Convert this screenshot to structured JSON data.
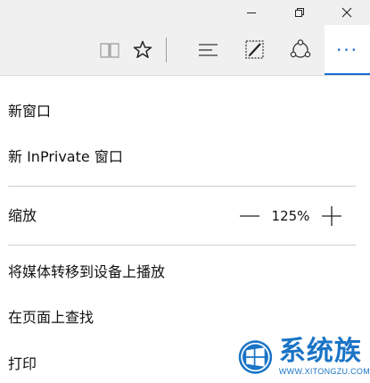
{
  "window_controls": {
    "minimize_icon": "minimize-icon",
    "restore_icon": "restore-icon",
    "close_icon": "close-icon"
  },
  "toolbar": {
    "items": [
      "reading-view-icon",
      "favorite-star-icon",
      "hub-icon",
      "web-note-icon",
      "share-icon",
      "more-icon"
    ],
    "more_glyph": "···",
    "accent": "#1a6dd0"
  },
  "menu": {
    "new_window": "新窗口",
    "new_inprivate": "新 InPrivate 窗口",
    "zoom_label": "缩放",
    "zoom_value": "125%",
    "cast": "将媒体转移到设备上播放",
    "find": "在页面上查找",
    "print": "打印"
  },
  "watermark": {
    "title": "系统族",
    "url": "WWW.XITONGZU.COM",
    "color": "#1a74c6"
  }
}
